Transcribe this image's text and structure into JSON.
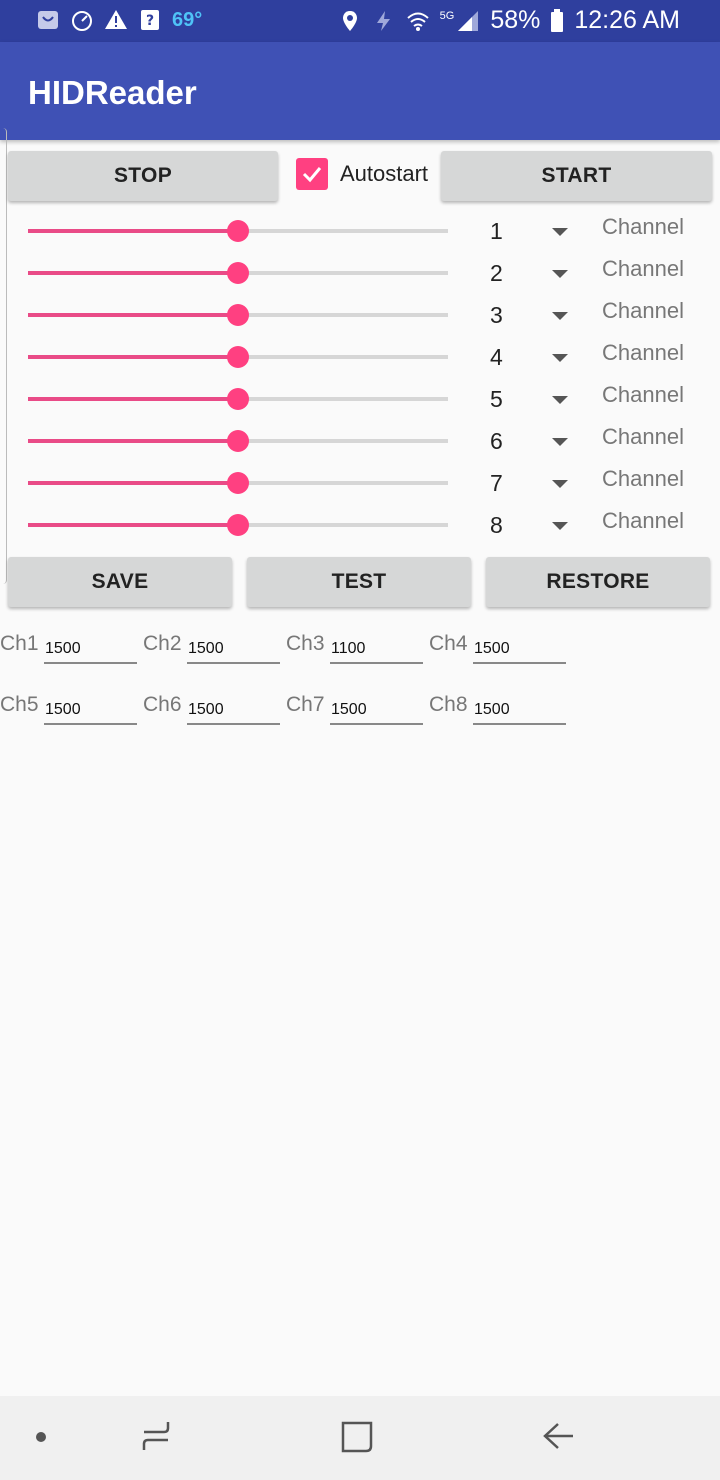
{
  "status_bar": {
    "temperature": "69°",
    "battery": "58%",
    "time": "12:26 AM",
    "network": "5G",
    "left_icons": [
      "bag-icon",
      "speedometer-icon",
      "warning-icon",
      "help-icon"
    ],
    "right_icons": [
      "location-icon",
      "data-saver-icon",
      "wifi-icon",
      "signal-icon",
      "battery-icon"
    ]
  },
  "app_bar": {
    "title": "HIDReader"
  },
  "controls": {
    "stop_label": "STOP",
    "autostart_label": "Autostart",
    "autostart_checked": true,
    "start_label": "START"
  },
  "sliders": [
    {
      "number": "1",
      "channel_hint": "Channel",
      "level": 0.5
    },
    {
      "number": "2",
      "channel_hint": "Channel",
      "level": 0.5
    },
    {
      "number": "3",
      "channel_hint": "Channel",
      "level": 0.5
    },
    {
      "number": "4",
      "channel_hint": "Channel",
      "level": 0.5
    },
    {
      "number": "5",
      "channel_hint": "Channel",
      "level": 0.5
    },
    {
      "number": "6",
      "channel_hint": "Channel",
      "level": 0.5
    },
    {
      "number": "7",
      "channel_hint": "Channel",
      "level": 0.5
    },
    {
      "number": "8",
      "channel_hint": "Channel",
      "level": 0.5
    }
  ],
  "actions": {
    "save_label": "SAVE",
    "test_label": "TEST",
    "restore_label": "RESTORE"
  },
  "channels": [
    {
      "label": "Ch1",
      "value": "1500"
    },
    {
      "label": "Ch2",
      "value": "1500"
    },
    {
      "label": "Ch3",
      "value": "1100"
    },
    {
      "label": "Ch4",
      "value": "1500"
    },
    {
      "label": "Ch5",
      "value": "1500"
    },
    {
      "label": "Ch6",
      "value": "1500"
    },
    {
      "label": "Ch7",
      "value": "1500"
    },
    {
      "label": "Ch8",
      "value": "1500"
    }
  ],
  "colors": {
    "primary": "#3f51b5",
    "primary_dark": "#2f3f9e",
    "accent": "#ff4081"
  }
}
